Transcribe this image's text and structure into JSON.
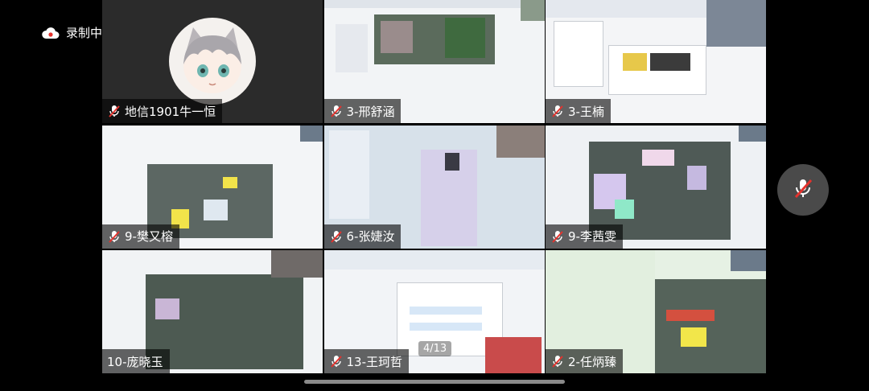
{
  "recording": {
    "label": "录制中",
    "icon": "cloud-record-icon"
  },
  "participants": [
    {
      "name": "地信1901牛一恒",
      "muted": true,
      "kind": "avatar"
    },
    {
      "name": "3-邢舒涵",
      "muted": true,
      "kind": "screen"
    },
    {
      "name": "3-王楠",
      "muted": true,
      "kind": "screen"
    },
    {
      "name": "9-樊又榕",
      "muted": true,
      "kind": "screen"
    },
    {
      "name": "6-张婕汝",
      "muted": true,
      "kind": "screen"
    },
    {
      "name": "9-李茜雯",
      "muted": true,
      "kind": "screen"
    },
    {
      "name": "10-庞晓玉",
      "muted": false,
      "kind": "screen"
    },
    {
      "name": "13-王珂哲",
      "muted": true,
      "kind": "screen"
    },
    {
      "name": "2-任炳臻",
      "muted": true,
      "kind": "screen"
    }
  ],
  "pagination": {
    "text": "4/13"
  },
  "controls": {
    "mute_button_icon": "mic-muted-icon"
  },
  "colors": {
    "background": "#000000",
    "label_bg": "rgba(0,0,0,0.6)",
    "mute_red": "#e5322d"
  }
}
